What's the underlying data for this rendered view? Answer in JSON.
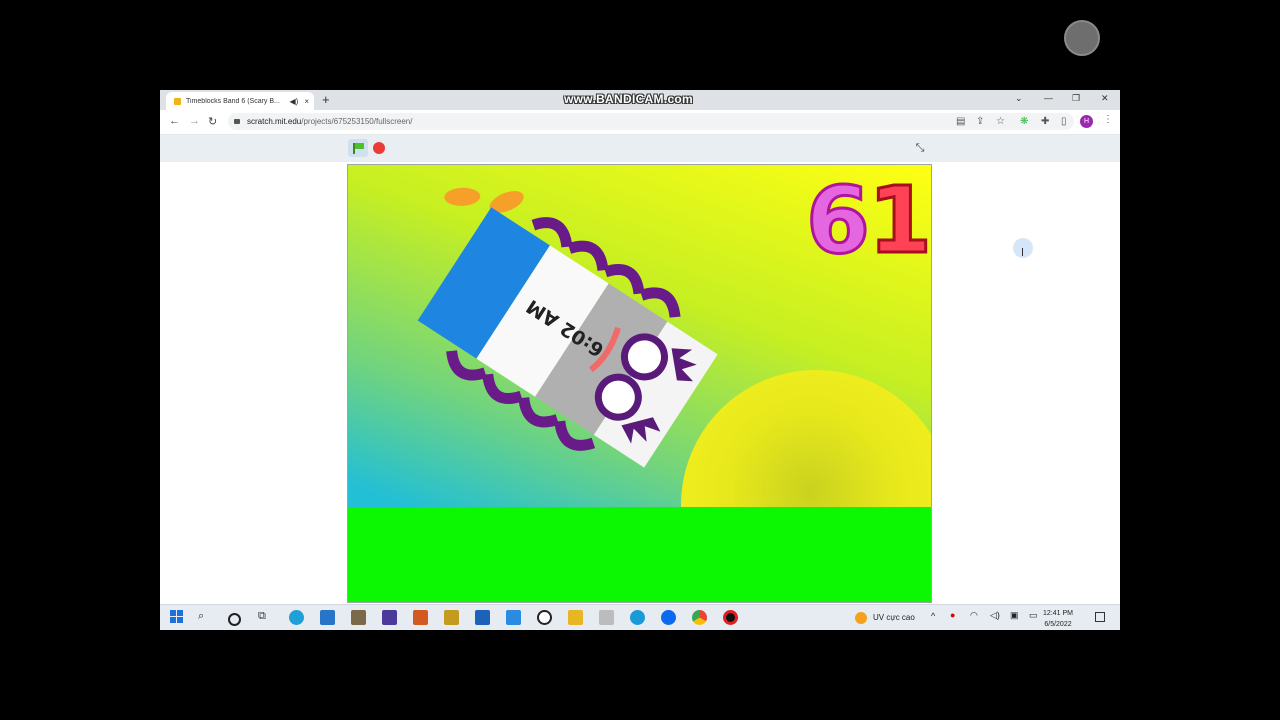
{
  "browser": {
    "tab_title": "Timeblocks Band 6 (Scary B...",
    "new_tab_symbol": "+",
    "audio_icon": "speaker-icon",
    "close_tab_symbol": "×",
    "minimize_symbol": "—",
    "restore_symbol": "❐",
    "close_symbol": "✕",
    "tab_list_symbol": "⌄",
    "back_symbol": "←",
    "forward_symbol": "→",
    "reload_symbol": "↻",
    "url_domain": "scratch.mit.edu",
    "url_path": "/projects/675253150/fullscreen/",
    "profile_initial": "H",
    "menu_symbol": "⋮"
  },
  "recorder": {
    "watermark": "www.BANDICAM.com"
  },
  "scratch": {
    "counter": {
      "tens": "6",
      "ones": "1"
    },
    "time_label": "6:02 AM",
    "exit_fullscreen_symbol": "⤡"
  },
  "taskbar": {
    "weather_text": "UV cực cao",
    "time": "12:41 PM",
    "date": "6/5/2022",
    "up_arrow": "^",
    "apps": [
      "photos",
      "dell",
      "paint",
      "squad",
      "game",
      "folder",
      "store",
      "mail",
      "dell-logo",
      "files",
      "tools",
      "edge",
      "zalo",
      "chrome",
      "bandicam"
    ]
  },
  "colors": {
    "sky_top": "#ffff13",
    "sky_bottom": "#21c8d4",
    "grass": "#0cf702",
    "sun": "#f3ef1e",
    "number_six": "#e567e0",
    "number_one": "#ff4255",
    "tentacles": "#6a1b8a"
  }
}
